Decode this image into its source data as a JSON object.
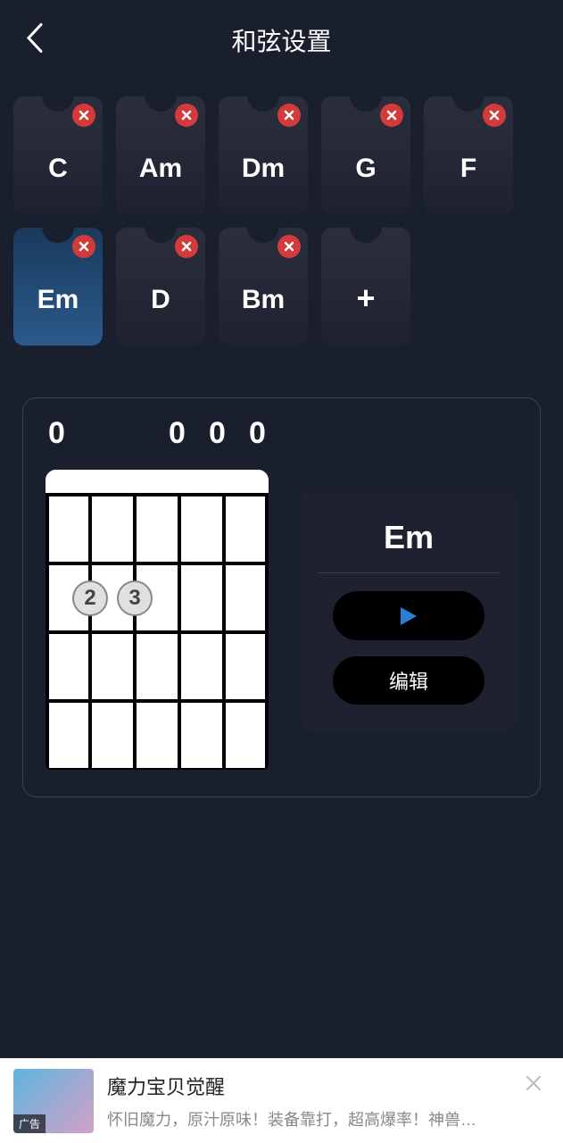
{
  "header": {
    "title": "和弦设置"
  },
  "chords": [
    {
      "label": "C",
      "selected": false
    },
    {
      "label": "Am",
      "selected": false
    },
    {
      "label": "Dm",
      "selected": false
    },
    {
      "label": "G",
      "selected": false
    },
    {
      "label": "F",
      "selected": false
    },
    {
      "label": "Em",
      "selected": true
    },
    {
      "label": "D",
      "selected": false
    },
    {
      "label": "Bm",
      "selected": false
    }
  ],
  "diagram": {
    "open_strings": [
      "0",
      "",
      "",
      "0",
      "0",
      "0"
    ],
    "fingers": [
      {
        "finger": "2",
        "string": 1,
        "fret": 2
      },
      {
        "finger": "3",
        "string": 2,
        "fret": 2
      }
    ]
  },
  "info": {
    "chord_name": "Em",
    "edit_label": "编辑"
  },
  "ad": {
    "tag": "广告",
    "title": "魔力宝贝觉醒",
    "description": "怀旧魔力，原汁原味！装备靠打，超高爆率！神兽…"
  }
}
